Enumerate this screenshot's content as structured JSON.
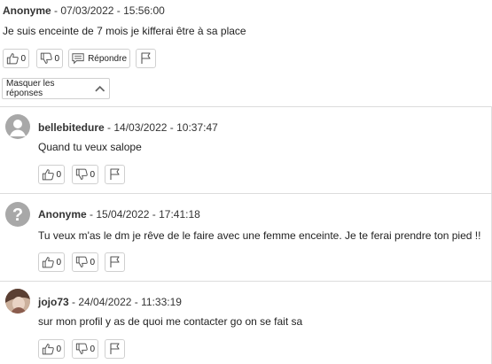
{
  "top_comment": {
    "author": "Anonyme",
    "date": "07/03/2022 - 15:56:00",
    "text": "Je suis enceinte de 7 mois je kifferai être à sa place",
    "likes": "0",
    "dislikes": "0",
    "reply_label": "Répondre"
  },
  "toggle_label": "Masquer les réponses",
  "replies": [
    {
      "author": "bellebitedure",
      "date": "14/03/2022 - 10:37:47",
      "text": "Quand tu veux salope",
      "likes": "0",
      "dislikes": "0",
      "avatar": "user-silhouette"
    },
    {
      "author": "Anonyme",
      "date": "15/04/2022 - 17:41:18",
      "text": "Tu veux m'as le dm je rêve de le faire avec une femme enceinte. Je te ferai prendre ton pied !!",
      "likes": "0",
      "dislikes": "0",
      "avatar": "question-mark"
    },
    {
      "author": "jojo73",
      "date": "24/04/2022 - 11:33:19",
      "text": "sur mon profil y as de quoi me contacter go on se fait sa",
      "likes": "0",
      "dislikes": "0",
      "avatar": "photo"
    }
  ],
  "colors": {
    "avatar_grey": "#a8a8a8",
    "border": "#d0d0d0",
    "divider": "#dcdcdc"
  }
}
